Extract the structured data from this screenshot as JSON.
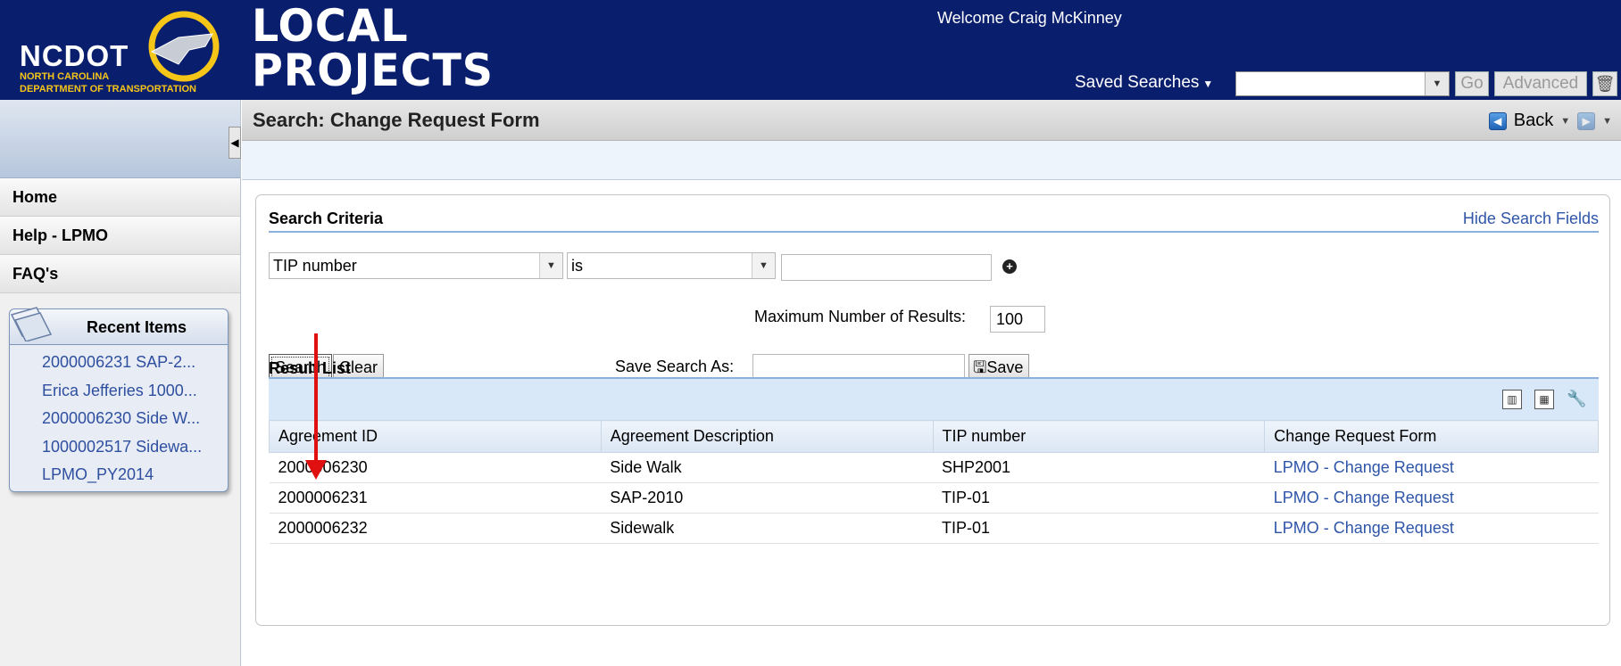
{
  "header": {
    "logo": {
      "name": "NCDOT",
      "sub1": "NORTH CAROLINA",
      "sub2": "DEPARTMENT OF TRANSPORTATION"
    },
    "app_title_line1": "LOCAL",
    "app_title_line2": "PROJECTS",
    "welcome": "Welcome Craig McKinney",
    "saved_searches_label": "Saved Searches",
    "saved_search_value": "",
    "go_label": "Go",
    "advanced_label": "Advanced",
    "brand_color": "#0a1e6e"
  },
  "sidebar": {
    "nav": [
      {
        "label": "Home"
      },
      {
        "label": "Help - LPMO"
      },
      {
        "label": "FAQ's"
      }
    ],
    "recent_title": "Recent Items",
    "recent_items": [
      "2000006231 SAP-2...",
      "Erica Jefferies 1000...",
      "2000006230 Side W...",
      "1000002517 Sidewa...",
      "LPMO_PY2014"
    ]
  },
  "titlebar": {
    "title": "Search: Change Request Form",
    "back_label": "Back"
  },
  "search": {
    "criteria_title": "Search Criteria",
    "hide_link": "Hide Search Fields",
    "field": "TIP number",
    "operator": "is",
    "value": "",
    "max_results_label": "Maximum Number of Results:",
    "max_results_value": "100",
    "search_button": "Search",
    "clear_button": "Clear",
    "save_as_label": "Save Search As:",
    "save_as_value": "",
    "save_button": "Save"
  },
  "results": {
    "title": "Result List",
    "columns": [
      "Agreement ID",
      "Agreement Description",
      "TIP number",
      "Change Request Form"
    ],
    "rows": [
      [
        "2000006230",
        "Side Walk",
        "SHP2001",
        "LPMO - Change Request"
      ],
      [
        "2000006231",
        "SAP-2010",
        "TIP-01",
        "LPMO - Change Request"
      ],
      [
        "2000006232",
        "Sidewalk",
        "TIP-01",
        "LPMO - Change Request"
      ]
    ]
  },
  "icons": {
    "toolbar": [
      "chart-icon",
      "export-excel-icon",
      "settings-wrench-icon"
    ],
    "annotation_arrow_color": "#e01010"
  }
}
